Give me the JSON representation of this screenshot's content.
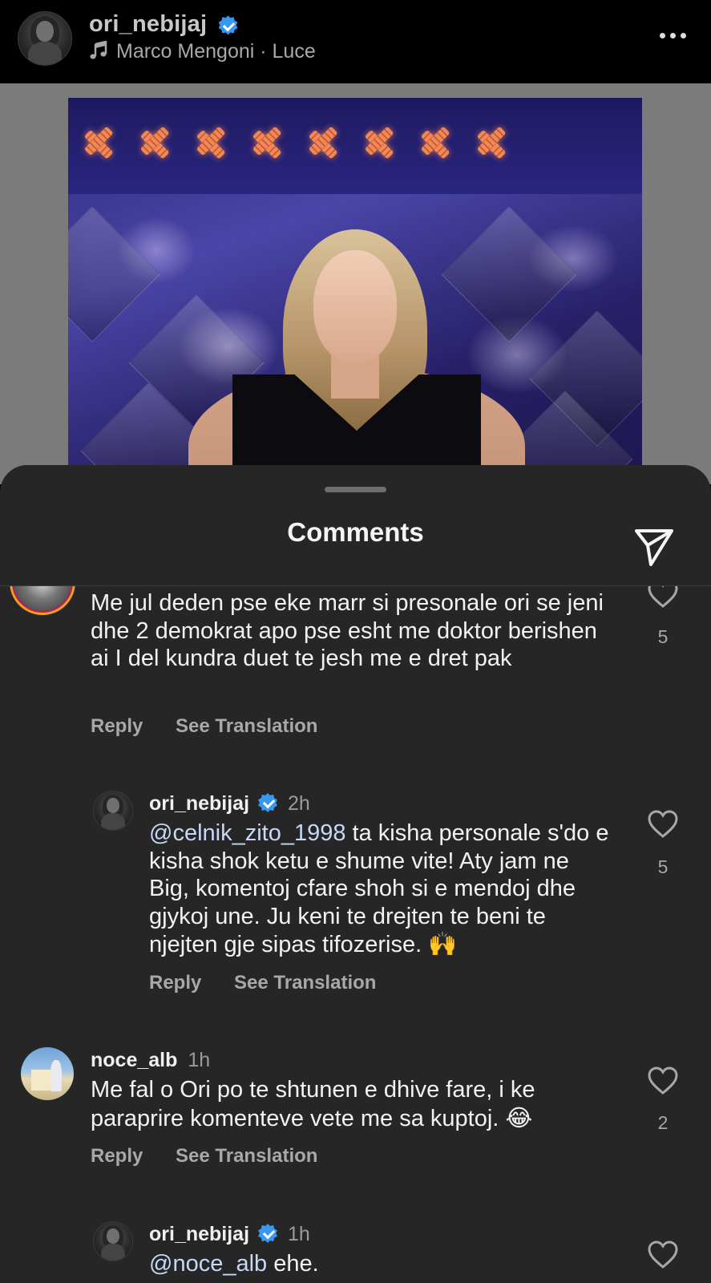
{
  "post": {
    "username": "ori_nebijaj",
    "music": "Marco Mengoni · Luce"
  },
  "sheet": {
    "title": "Comments"
  },
  "comments": [
    {
      "text": "Me jul deden pse eke marr si presonale ori se jeni dhe 2 demokrat apo pse esht me doktor berishen ai I del kundra duet te jesh me e dret pak",
      "likes": "5",
      "reply_label": "Reply",
      "translate_label": "See Translation"
    },
    {
      "username": "ori_nebijaj",
      "time": "2h",
      "mention": "@celnik_zito_1998",
      "text": " ta kisha personale s'do e kisha shok ketu e shume vite! Aty jam ne Big, komentoj cfare shoh si e mendoj dhe gjykoj une. Ju keni te drejten te beni te njejten gje sipas tifozerise. ",
      "emoji": "🙌",
      "likes": "5",
      "reply_label": "Reply",
      "translate_label": "See Translation"
    },
    {
      "username": "noce_alb",
      "time": "1h",
      "text": "Me fal o Ori po te shtunen e dhive fare, i ke paraprire komenteve vete me sa kuptoj. ",
      "emoji": "😂",
      "likes": "2",
      "reply_label": "Reply",
      "translate_label": "See Translation"
    },
    {
      "username": "ori_nebijaj",
      "time": "1h",
      "mention": "@noce_alb",
      "text": " ehe."
    }
  ],
  "colors": {
    "verified": "#3897f0",
    "sheet_bg": "#262626",
    "mention": "#c5d9f5"
  },
  "icons": [
    "music-note-icon",
    "more-icon",
    "send-icon",
    "heart-icon",
    "verified-badge-icon"
  ]
}
